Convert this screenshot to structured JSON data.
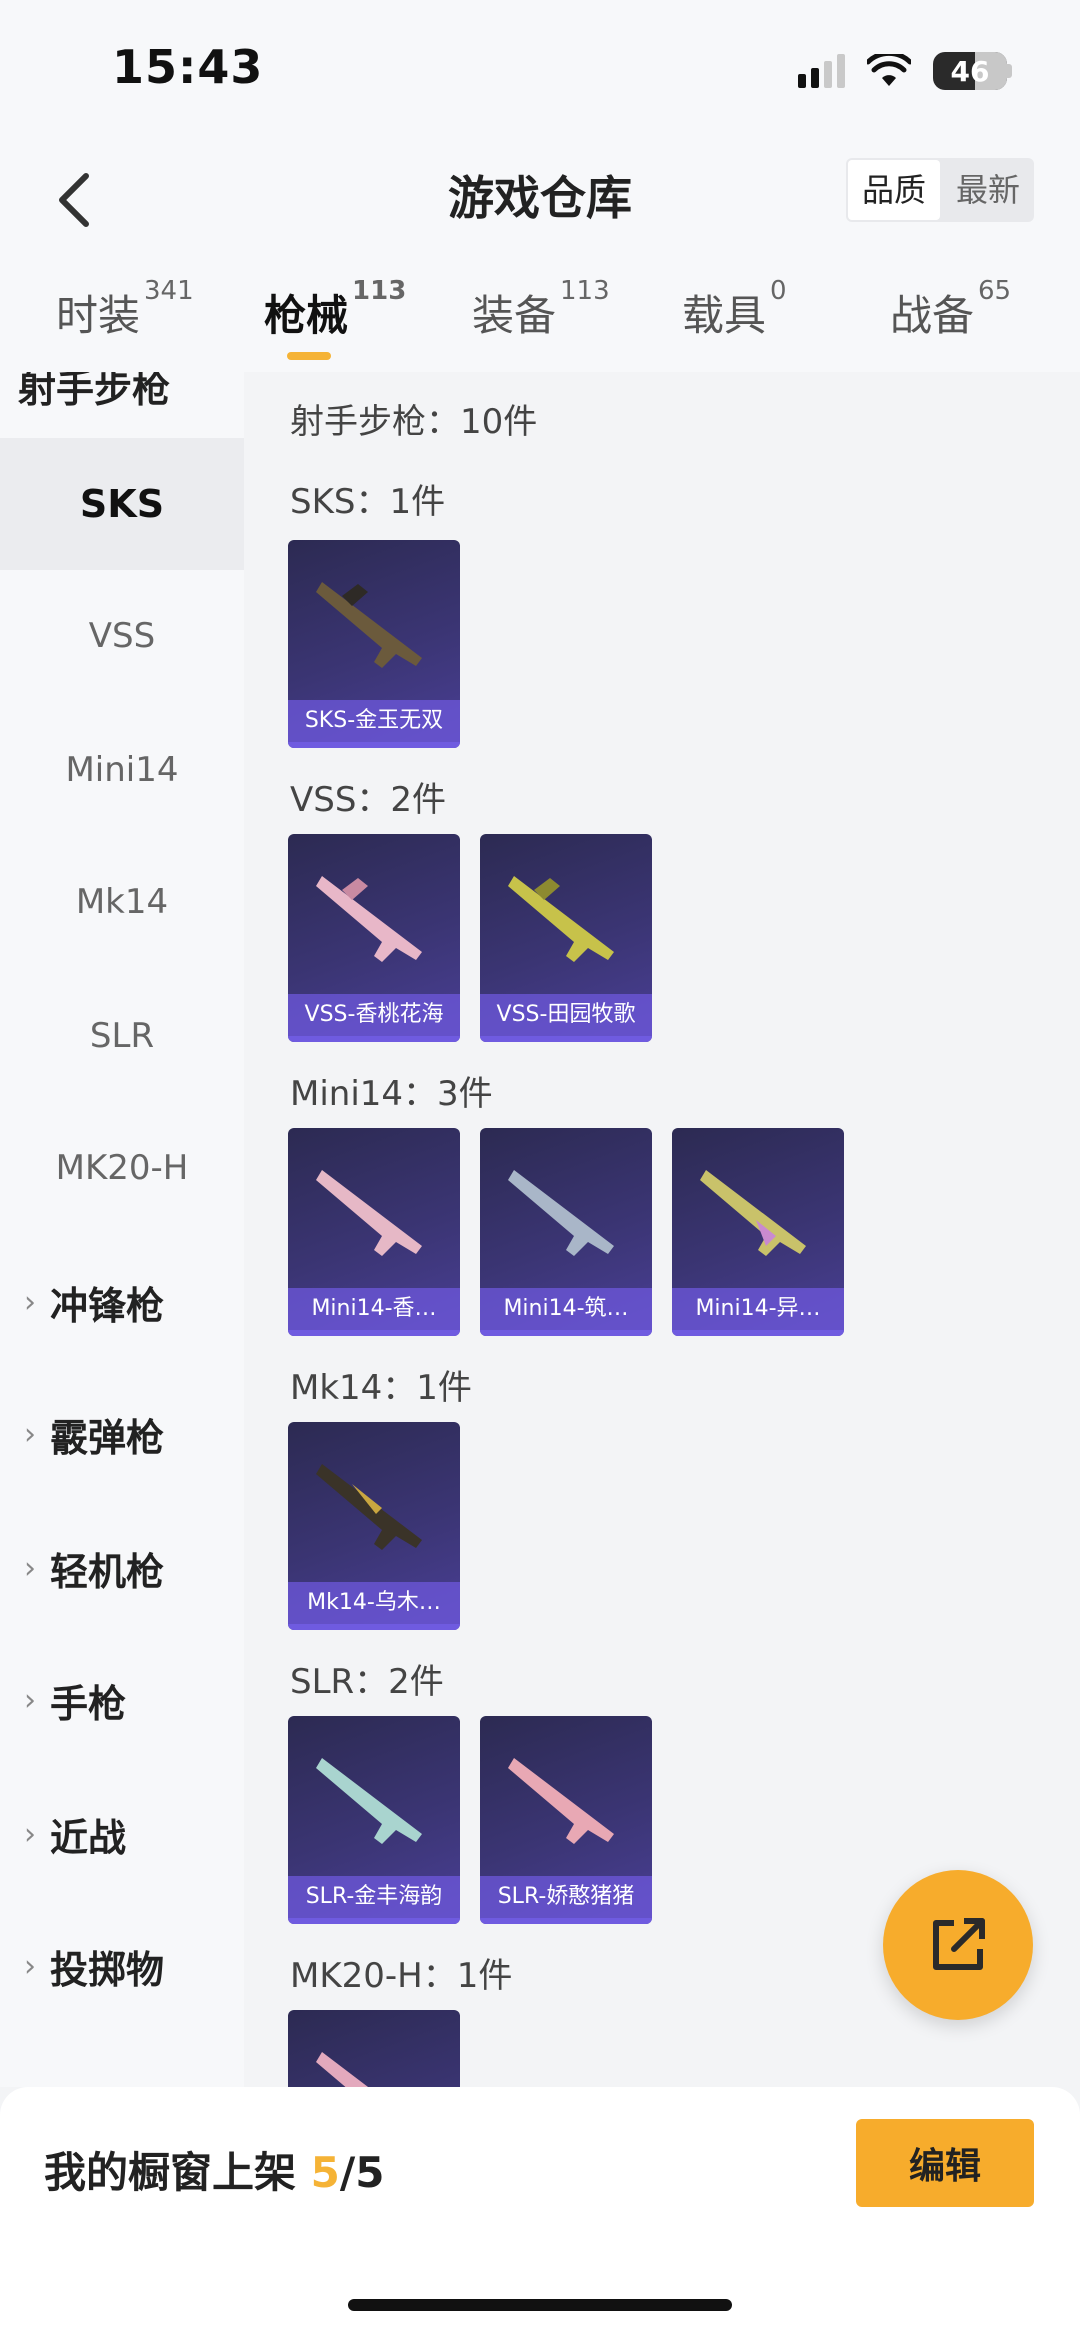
{
  "status_bar": {
    "time": "15:43",
    "battery": "46"
  },
  "header": {
    "title": "游戏仓库",
    "sort_options": [
      "品质",
      "最新"
    ],
    "active_sort": "品质"
  },
  "tabs": [
    {
      "label": "时装",
      "count": "341"
    },
    {
      "label": "枪械",
      "count": "113"
    },
    {
      "label": "装备",
      "count": "113"
    },
    {
      "label": "载具",
      "count": "0"
    },
    {
      "label": "战备",
      "count": "65"
    }
  ],
  "sidebar": {
    "current_category": "射手步枪",
    "subcategories": [
      "SKS",
      "VSS",
      "Mini14",
      "Mk14",
      "SLR",
      "MK20-H"
    ],
    "categories": [
      "冲锋枪",
      "霰弹枪",
      "轻机枪",
      "手枪",
      "近战",
      "投掷物"
    ]
  },
  "content": {
    "section_title": "射手步枪：10件",
    "groups": [
      {
        "title": "SKS：1件",
        "items": [
          "SKS-金玉无双"
        ]
      },
      {
        "title": "VSS：2件",
        "items": [
          "VSS-香桃花海",
          "VSS-田园牧歌"
        ]
      },
      {
        "title": "Mini14：3件",
        "items": [
          "Mini14-香…",
          "Mini14-筑…",
          "Mini14-异…"
        ]
      },
      {
        "title": "Mk14：1件",
        "items": [
          "Mk14-乌木…"
        ]
      },
      {
        "title": "SLR：2件",
        "items": [
          "SLR-金丰海韵",
          "SLR-娇憨猪猪"
        ]
      },
      {
        "title": "MK20-H：1件",
        "items": []
      }
    ]
  },
  "bottom": {
    "showcase_label": "我的橱窗上架",
    "showcase_used": "5",
    "showcase_total": "/5",
    "edit_label": "编辑"
  },
  "colors": {
    "accent": "#f5b336",
    "card_bg": "#3b3574",
    "card_label": "#6e58dc"
  },
  "icons": {
    "back": "chevron-left-icon",
    "share": "share-icon"
  }
}
